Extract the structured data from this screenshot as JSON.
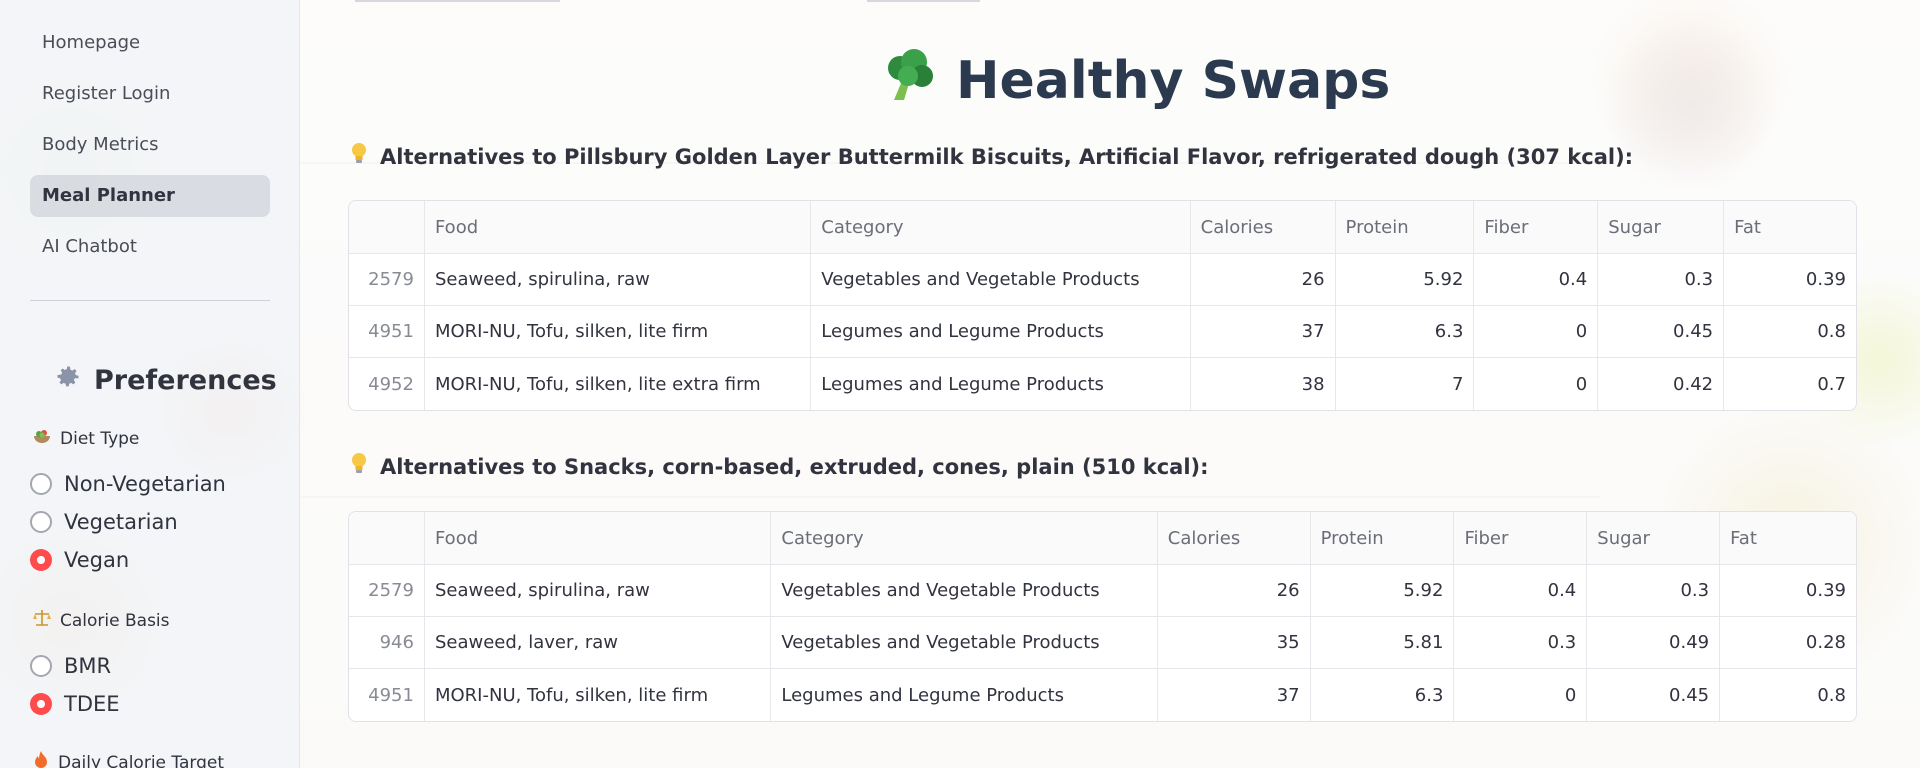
{
  "sidebar": {
    "nav": [
      "Homepage",
      "Register Login",
      "Body Metrics",
      "Meal Planner",
      "AI Chatbot"
    ],
    "active_nav": "Meal Planner",
    "preferences_title": "Preferences",
    "diet_type": {
      "label": "Diet Type",
      "options": [
        "Non-Vegetarian",
        "Vegetarian",
        "Vegan"
      ],
      "selected": "Vegan"
    },
    "calorie_basis": {
      "label": "Calorie Basis",
      "options": [
        "BMR",
        "TDEE"
      ],
      "selected": "TDEE"
    },
    "daily_target_label": "Daily Calorie Target"
  },
  "main": {
    "title": "Healthy Swaps",
    "sections": [
      {
        "heading": "Alternatives to Pillsbury Golden Layer Buttermilk Biscuits, Artificial Flavor, refrigerated dough (307 kcal):",
        "columns": [
          "",
          "Food",
          "Category",
          "Calories",
          "Protein",
          "Fiber",
          "Sugar",
          "Fat"
        ],
        "rows": [
          [
            "2579",
            "Seaweed, spirulina, raw",
            "Vegetables and Vegetable Products",
            "26",
            "5.92",
            "0.4",
            "0.3",
            "0.39"
          ],
          [
            "4951",
            "MORI-NU, Tofu, silken, lite firm",
            "Legumes and Legume Products",
            "37",
            "6.3",
            "0",
            "0.45",
            "0.8"
          ],
          [
            "4952",
            "MORI-NU, Tofu, silken, lite extra firm",
            "Legumes and Legume Products",
            "38",
            "7",
            "0",
            "0.42",
            "0.7"
          ]
        ]
      },
      {
        "heading": "Alternatives to Snacks, corn-based, extruded, cones, plain (510 kcal):",
        "columns": [
          "",
          "Food",
          "Category",
          "Calories",
          "Protein",
          "Fiber",
          "Sugar",
          "Fat"
        ],
        "rows": [
          [
            "2579",
            "Seaweed, spirulina, raw",
            "Vegetables and Vegetable Products",
            "26",
            "5.92",
            "0.4",
            "0.3",
            "0.39"
          ],
          [
            "946",
            "Seaweed, laver, raw",
            "Vegetables and Vegetable Products",
            "35",
            "5.81",
            "0.3",
            "0.49",
            "0.28"
          ],
          [
            "4951",
            "MORI-NU, Tofu, silken, lite firm",
            "Legumes and Legume Products",
            "37",
            "6.3",
            "0",
            "0.45",
            "0.8"
          ]
        ]
      }
    ]
  },
  "colors": {
    "accent": "#ff4b4b",
    "title": "#2c3a4f",
    "sidebar_bg": "#f0f2f6"
  },
  "icons": {
    "title": "broccoli-icon",
    "section": "lightbulb-icon",
    "preferences": "gear-icon",
    "diet_type": "salad-bowl-icon",
    "calorie_basis": "balance-scale-icon",
    "daily_target": "fire-icon"
  }
}
